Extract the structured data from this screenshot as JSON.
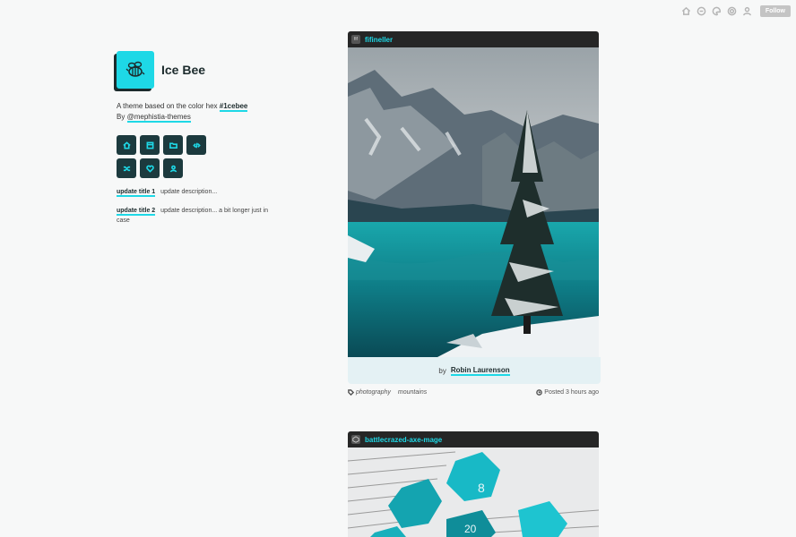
{
  "topbar": {
    "icons": [
      "home-icon",
      "message-icon",
      "palette-icon",
      "settings-icon",
      "user-icon"
    ],
    "follow_label": "Follow"
  },
  "sidebar": {
    "title": "Ice Bee",
    "description_prefix": "A theme based on the color hex",
    "description_hex": "#1cebee",
    "description_by": "By",
    "description_author": "@mephistia-themes",
    "nav_icons": [
      "home-icon",
      "archive-icon",
      "folder-icon",
      "code-icon",
      "shuffle-icon",
      "heart-icon",
      "user-icon"
    ],
    "updates": [
      {
        "title": "update title 1",
        "text": "update description..."
      },
      {
        "title": "update title 2",
        "text": "update description... a bit longer just in case"
      }
    ]
  },
  "posts": [
    {
      "username": "fifineller",
      "avatar_text": "fif",
      "caption_by": "by",
      "caption_author": "Robin Laurenson",
      "tags": [
        "photography",
        "mountains"
      ],
      "posted": "Posted 3 hours ago"
    },
    {
      "username": "battlecrazed-axe-mage"
    }
  ],
  "colors": {
    "accent": "#1ed8e6",
    "dark": "#1c2b2d",
    "header": "#262626",
    "caption_bg": "#e4f1f4"
  }
}
